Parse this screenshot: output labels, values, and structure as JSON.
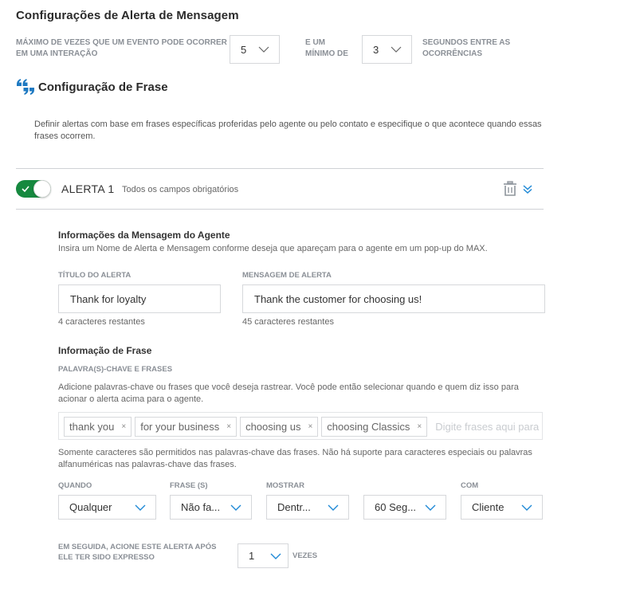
{
  "page": {
    "title": "Configurações de Alerta de Mensagem"
  },
  "limits": {
    "max_label_line1": "MÁXIMO DE VEZES QUE UM EVENTO PODE OCORRER",
    "max_label_line2": "EM UMA INTERAÇÃO",
    "max_value": "5",
    "min_label_line1": "E UM",
    "min_label_line2": "MÍNIMO DE",
    "min_value": "3",
    "seconds_label_line1": "SEGUNDOS ENTRE AS",
    "seconds_label_line2": "OCORRÊNCIAS"
  },
  "phrase_section": {
    "title": "Configuração de Frase",
    "icon": "quote-icon",
    "description": "Definir alertas com base em frases específicas proferidas pelo agente ou pelo contato e especifique o que acontece quando essas frases ocorrem."
  },
  "alert": {
    "enabled": true,
    "name": "ALERTA 1",
    "required_note": "Todos os campos obrigatórios",
    "accent_color": "#16893f",
    "icons": [
      "trash-icon",
      "chevron-double-down-icon"
    ]
  },
  "agent_message": {
    "title": "Informações da Mensagem do Agente",
    "description": "Insira um Nome de Alerta e Mensagem conforme deseja que apareçam para o agente em um pop-up do MAX.",
    "alert_title_label": "TÍTULO DO ALERTA",
    "alert_title_value": "Thank for loyalty",
    "alert_title_remaining": "4 caracteres restantes",
    "alert_message_label": "MENSAGEM DE ALERTA",
    "alert_message_value": "Thank the customer for choosing us!",
    "alert_message_remaining": "45 caracteres restantes"
  },
  "phrase_info": {
    "title": "Informação de Frase",
    "keywords_label": "PALAVRA(S)-CHAVE E FRASES",
    "keywords_desc": "Adicione palavras-chave ou frases que você deseja rastrear. Você pode então selecionar quando e quem diz isso para acionar o alerta acima para o agente.",
    "tags": [
      "thank you",
      "for your business",
      "choosing us",
      "choosing Classics"
    ],
    "tag_remove_glyph": "×",
    "input_placeholder": "Digite frases aqui para a",
    "note": "Somente caracteres são permitidos nas palavras-chave das frases. Não há suporte para caracteres especiais ou palavras alfanuméricas nas palavras-chave das frases."
  },
  "conditions": {
    "when_label": "QUANDO",
    "when_value": "Qualquer",
    "phrase_label": "FRASE (S)",
    "phrase_value": "Não fa...",
    "show_label": "MOSTRAR",
    "show_value": "Dentr...",
    "time_value": "60 Seg...",
    "with_label": "COM",
    "with_value": "Cliente"
  },
  "trigger": {
    "label_line1": "EM SEGUIDA, ACIONE ESTE ALERTA APÓS",
    "label_line2": "ELE TER SIDO EXPRESSO",
    "count_value": "1",
    "times_label": "VEZES"
  }
}
